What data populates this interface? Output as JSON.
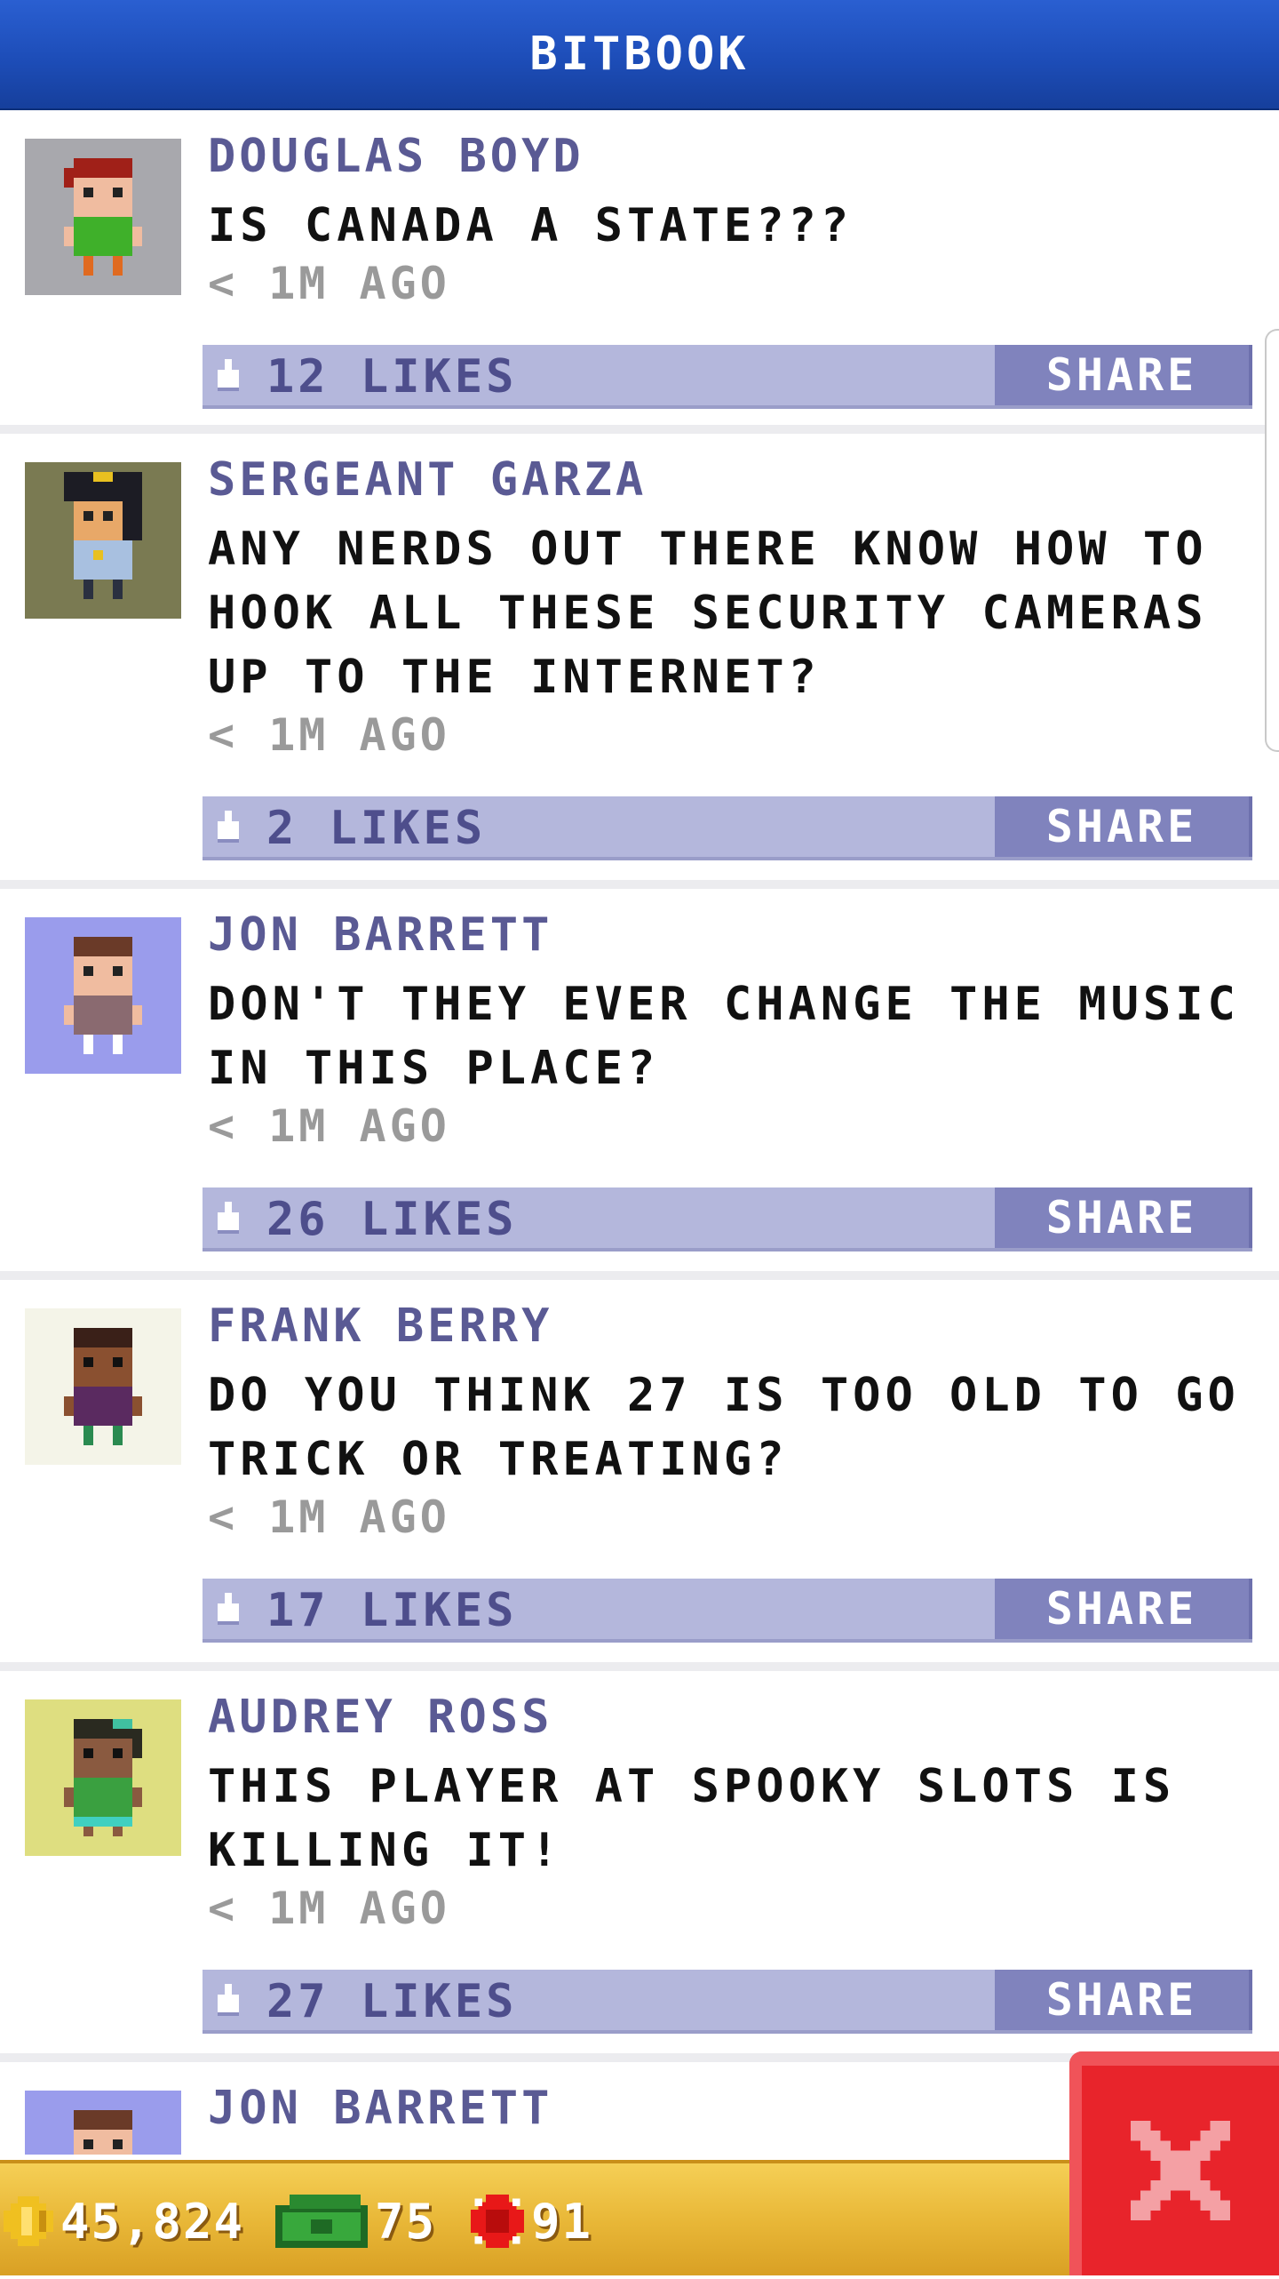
{
  "header": {
    "title": "BITBOOK"
  },
  "posts": [
    {
      "author": "DOUGLAS BOYD",
      "message": "IS CANADA A STATE???",
      "time": "< 1M AGO",
      "likes": "12 LIKES",
      "share": "SHARE",
      "avatar_bg": "#a8a8ad"
    },
    {
      "author": "SERGEANT GARZA",
      "message": "ANY NERDS OUT THERE KNOW HOW TO HOOK ALL THESE SECURITY CAMERAS UP TO THE INTERNET?",
      "time": "< 1M AGO",
      "likes": "2 LIKES",
      "share": "SHARE",
      "avatar_bg": "#7a7a52"
    },
    {
      "author": "JON BARRETT",
      "message": "DON'T THEY EVER CHANGE THE MUSIC IN THIS PLACE?",
      "time": "< 1M AGO",
      "likes": "26 LIKES",
      "share": "SHARE",
      "avatar_bg": "#9a9cec"
    },
    {
      "author": "FRANK BERRY",
      "message": "DO YOU THINK 27 IS TOO OLD TO GO TRICK OR TREATING?",
      "time": "< 1M AGO",
      "likes": "17 LIKES",
      "share": "SHARE",
      "avatar_bg": "#f4f4e8"
    },
    {
      "author": "AUDREY ROSS",
      "message": "THIS PLAYER AT SPOOKY SLOTS IS KILLING IT!",
      "time": "< 1M AGO",
      "likes": "27 LIKES",
      "share": "SHARE",
      "avatar_bg": "#dede80"
    },
    {
      "author": "JON BARRETT",
      "avatar_bg": "#9a9cec"
    }
  ],
  "status": {
    "coins": "45,824",
    "bux": "75",
    "tickets": "91"
  },
  "colors": {
    "header": "#1d4db8",
    "likes_bar": "#b4b7dc",
    "share_button": "#8083bd",
    "close_button": "#e8242b",
    "status_bar": "#e9b838"
  },
  "icons": {
    "like": "thumbs-up-icon",
    "coin": "coin-icon",
    "bux": "bux-icon",
    "ticket": "ticket-icon",
    "close": "close-icon"
  }
}
